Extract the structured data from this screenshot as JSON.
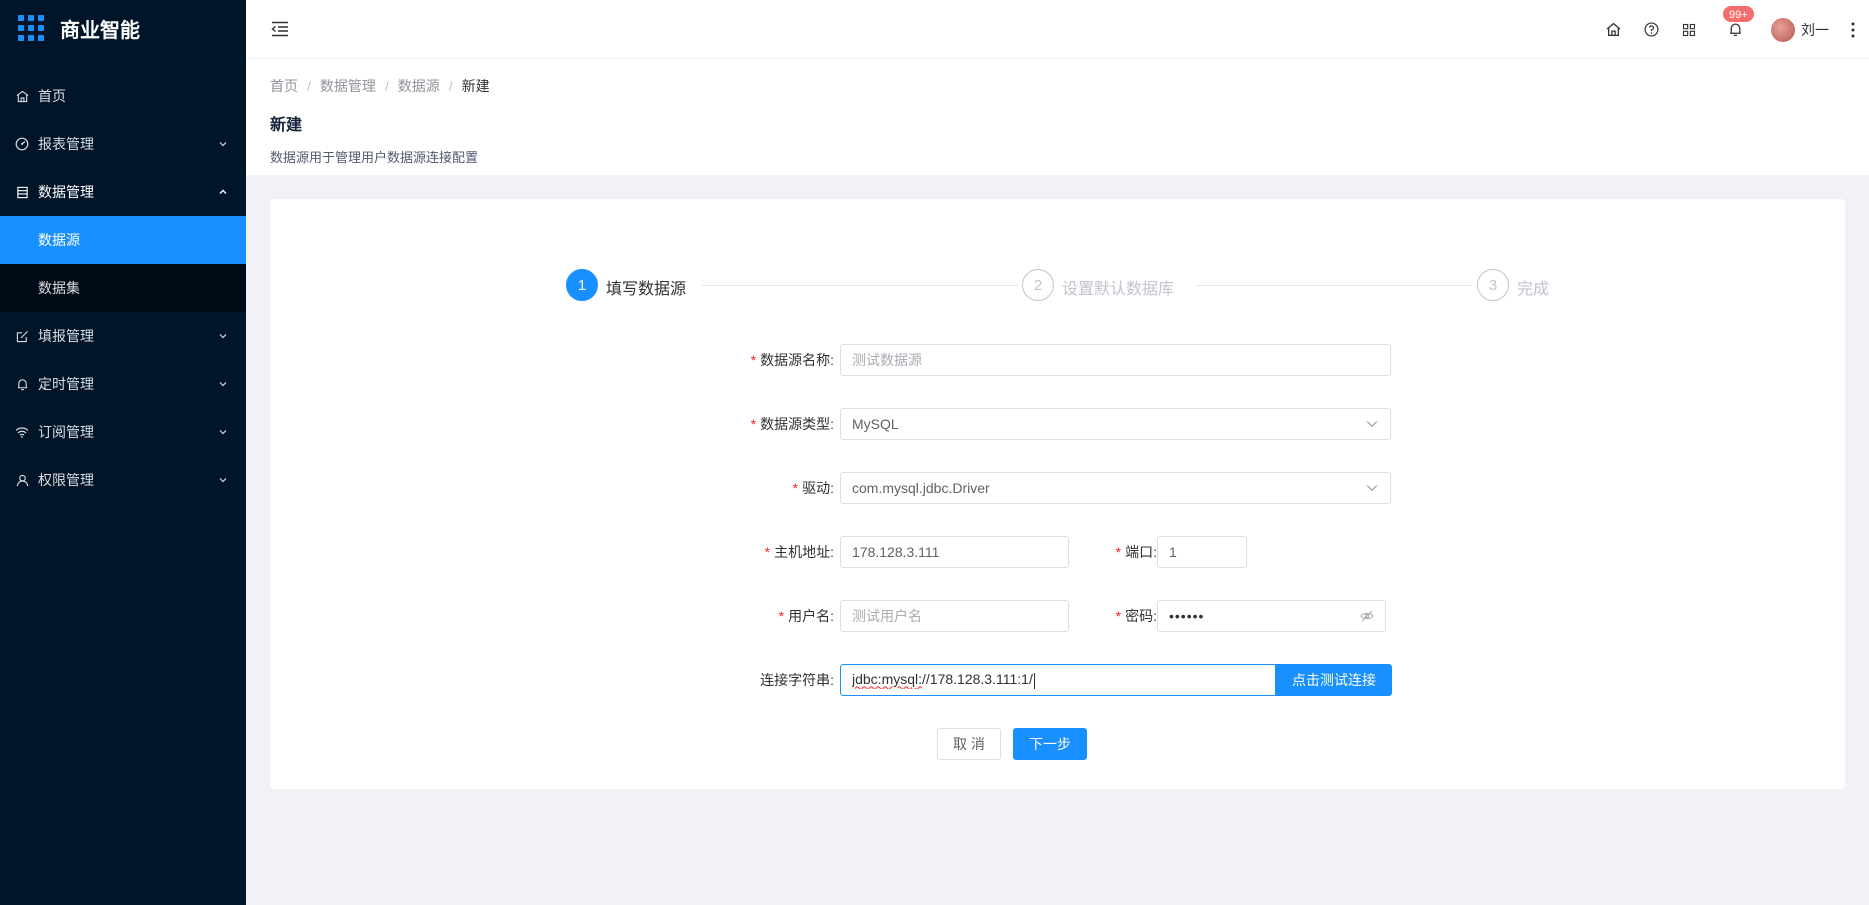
{
  "app": {
    "title": "商业智能"
  },
  "sidebar": {
    "items": [
      {
        "label": "首页",
        "icon": "home-icon"
      },
      {
        "label": "报表管理",
        "icon": "dashboard-icon"
      },
      {
        "label": "数据管理",
        "icon": "database-icon",
        "expanded": true,
        "children": [
          {
            "label": "数据源",
            "active": true
          },
          {
            "label": "数据集"
          }
        ]
      },
      {
        "label": "填报管理",
        "icon": "edit-icon"
      },
      {
        "label": "定时管理",
        "icon": "bell-icon"
      },
      {
        "label": "订阅管理",
        "icon": "wifi-icon"
      },
      {
        "label": "权限管理",
        "icon": "user-icon"
      }
    ]
  },
  "header": {
    "notifications_badge": "99+",
    "user_name": "刘一",
    "icons": [
      "home-icon",
      "help-icon",
      "apps-icon",
      "bell-icon",
      "more-vertical-icon"
    ]
  },
  "breadcrumb": [
    "首页",
    "数据管理",
    "数据源",
    "新建"
  ],
  "page": {
    "title": "新建",
    "description": "数据源用于管理用户数据源连接配置"
  },
  "steps": [
    {
      "number": "1",
      "label": "填写数据源",
      "active": true
    },
    {
      "number": "2",
      "label": "设置默认数据库",
      "active": false
    },
    {
      "number": "3",
      "label": "完成",
      "active": false
    }
  ],
  "form": {
    "name": {
      "label": "数据源名称:",
      "placeholder": "测试数据源"
    },
    "type": {
      "label": "数据源类型:",
      "value": "MySQL"
    },
    "driver": {
      "label": "驱动:",
      "value": "com.mysql.jdbc.Driver"
    },
    "host": {
      "label": "主机地址:",
      "value": "178.128.3.111"
    },
    "port": {
      "label": "端口:",
      "value": "1"
    },
    "username": {
      "label": "用户名:",
      "placeholder": "测试用户名"
    },
    "password": {
      "label": "密码:",
      "value": "••••••"
    },
    "connection": {
      "label": "连接字符串:",
      "value_prefix": "jdbc:mysql:",
      "value_rest": "//178.128.3.111:1/",
      "test_button": "点击测试连接"
    }
  },
  "actions": {
    "cancel": "取 消",
    "next": "下一步"
  },
  "colors": {
    "primary": "#1890ff",
    "sidebar_bg": "#001529",
    "required": "#f5222d",
    "badge": "#f56c6c"
  }
}
